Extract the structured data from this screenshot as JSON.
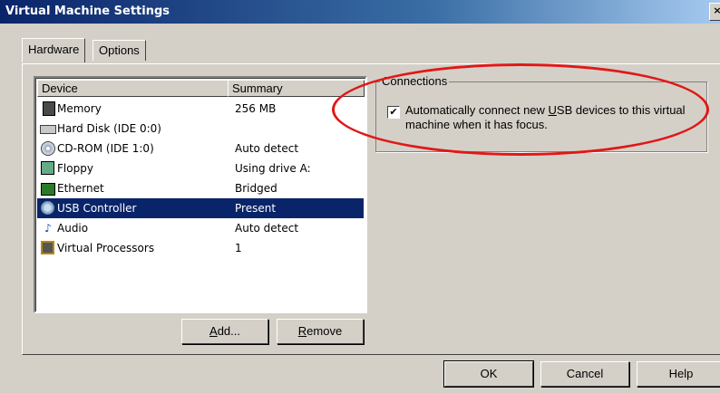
{
  "window": {
    "title": "Virtual Machine Settings",
    "close_glyph": "×"
  },
  "tabs": [
    {
      "label": "Hardware",
      "active": true
    },
    {
      "label": "Options",
      "active": false
    }
  ],
  "device_list": {
    "columns": [
      "Device",
      "Summary"
    ],
    "rows": [
      {
        "device": "Memory",
        "summary": "256 MB",
        "icon": "memory-icon",
        "selected": false
      },
      {
        "device": "Hard Disk (IDE 0:0)",
        "summary": "",
        "icon": "hard-disk-icon",
        "selected": false
      },
      {
        "device": "CD-ROM (IDE 1:0)",
        "summary": "Auto detect",
        "icon": "cdrom-icon",
        "selected": false
      },
      {
        "device": "Floppy",
        "summary": "Using drive A:",
        "icon": "floppy-icon",
        "selected": false
      },
      {
        "device": "Ethernet",
        "summary": "Bridged",
        "icon": "ethernet-icon",
        "selected": false
      },
      {
        "device": "USB Controller",
        "summary": "Present",
        "icon": "usb-icon",
        "selected": true
      },
      {
        "device": "Audio",
        "summary": "Auto detect",
        "icon": "audio-icon",
        "selected": false
      },
      {
        "device": "Virtual Processors",
        "summary": "1",
        "icon": "processor-icon",
        "selected": false
      }
    ]
  },
  "buttons": {
    "add_pre": "",
    "add_u": "A",
    "add_post": "dd...",
    "remove_pre": "",
    "remove_u": "R",
    "remove_post": "emove",
    "ok": "OK",
    "cancel": "Cancel",
    "help": "Help"
  },
  "connections": {
    "legend": "Connections",
    "checked": true,
    "label_pre": "Automatically connect new ",
    "label_u": "U",
    "label_post": "SB devices to this virtual machine when it has focus."
  },
  "colors": {
    "selection": "#0a246a",
    "annotation": "#e01818"
  }
}
